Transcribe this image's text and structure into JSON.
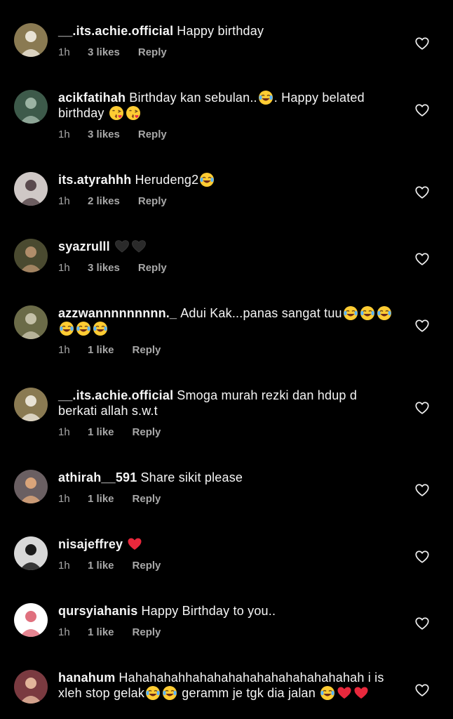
{
  "comments": [
    {
      "username": "__.its.achie.official",
      "text_parts": [
        {
          "text": "Happy birthday"
        }
      ],
      "time": "1h",
      "likes": "3 likes",
      "reply": "Reply",
      "avatar": {
        "bg": "#8a7a52",
        "accent": "#e8e2d4"
      }
    },
    {
      "username": "acikfatihah",
      "text_parts": [
        {
          "text": "Birthday kan sebulan.."
        },
        {
          "emoji": "joy-emoji"
        },
        {
          "text": ". Happy belated birthday "
        },
        {
          "emoji": "kiss-emoji"
        },
        {
          "emoji": "kiss-emoji"
        }
      ],
      "time": "1h",
      "likes": "3 likes",
      "reply": "Reply",
      "avatar": {
        "bg": "#3d5a4a",
        "accent": "#9bb3a3"
      }
    },
    {
      "username": "its.atyrahhh",
      "text_parts": [
        {
          "text": "Herudeng2"
        },
        {
          "emoji": "joy-emoji"
        }
      ],
      "time": "1h",
      "likes": "2 likes",
      "reply": "Reply",
      "avatar": {
        "bg": "#cfc8c6",
        "accent": "#5a4a4e"
      }
    },
    {
      "username": "syazrulll",
      "text_parts": [
        {
          "emoji": "black-heart-emoji"
        },
        {
          "emoji": "black-heart-emoji"
        }
      ],
      "time": "1h",
      "likes": "3 likes",
      "reply": "Reply",
      "avatar": {
        "bg": "#4a4a30",
        "accent": "#b08d6a"
      }
    },
    {
      "username": "azzwannnnnnnnn._",
      "text_parts": [
        {
          "text": "Adui Kak...panas sangat tuu"
        },
        {
          "emoji": "joy-emoji"
        },
        {
          "emoji": "joy-emoji"
        },
        {
          "emoji": "joy-emoji"
        },
        {
          "emoji": "joy-emoji"
        },
        {
          "emoji": "joy-emoji"
        },
        {
          "emoji": "joy-emoji"
        }
      ],
      "time": "1h",
      "likes": "1 like",
      "reply": "Reply",
      "avatar": {
        "bg": "#6b6b48",
        "accent": "#c4c0a8"
      }
    },
    {
      "username": "__.its.achie.official",
      "text_parts": [
        {
          "text": "Smoga murah rezki dan hdup d berkati allah s.w.t"
        }
      ],
      "time": "1h",
      "likes": "1 like",
      "reply": "Reply",
      "avatar": {
        "bg": "#8a7a52",
        "accent": "#e8e2d4"
      }
    },
    {
      "username": "athirah__591",
      "text_parts": [
        {
          "text": "Share sikit please"
        }
      ],
      "time": "1h",
      "likes": "1 like",
      "reply": "Reply",
      "avatar": {
        "bg": "#6a5f62",
        "accent": "#d9a47a"
      }
    },
    {
      "username": "nisajeffrey",
      "text_parts": [
        {
          "emoji": "red-heart-emoji"
        }
      ],
      "time": "1h",
      "likes": "1 like",
      "reply": "Reply",
      "avatar": {
        "bg": "#d8d8d8",
        "accent": "#1a1a1a"
      }
    },
    {
      "username": "qursyiahanis",
      "text_parts": [
        {
          "text": "Happy Birthday to you.."
        }
      ],
      "time": "1h",
      "likes": "1 like",
      "reply": "Reply",
      "avatar": {
        "bg": "#ffffff",
        "accent": "#e0707e"
      }
    },
    {
      "username": "hanahum",
      "text_parts": [
        {
          "text": "Hahahahahhahahahahahahahahahahahah i is xleh stop gelak"
        },
        {
          "emoji": "joy-emoji"
        },
        {
          "emoji": "joy-emoji"
        },
        {
          "text": " geramm je tgk dia jalan "
        },
        {
          "emoji": "joy-emoji"
        },
        {
          "emoji": "red-heart-emoji"
        },
        {
          "emoji": "red-heart-emoji"
        }
      ],
      "time": "",
      "likes": "",
      "reply": "",
      "avatar": {
        "bg": "#7a3a40",
        "accent": "#e2b49a"
      }
    }
  ],
  "icons": {
    "like": "heart-outline-icon"
  },
  "colors": {
    "background": "#000000",
    "text": "#f5f5f5",
    "meta": "#a8a8a8"
  }
}
